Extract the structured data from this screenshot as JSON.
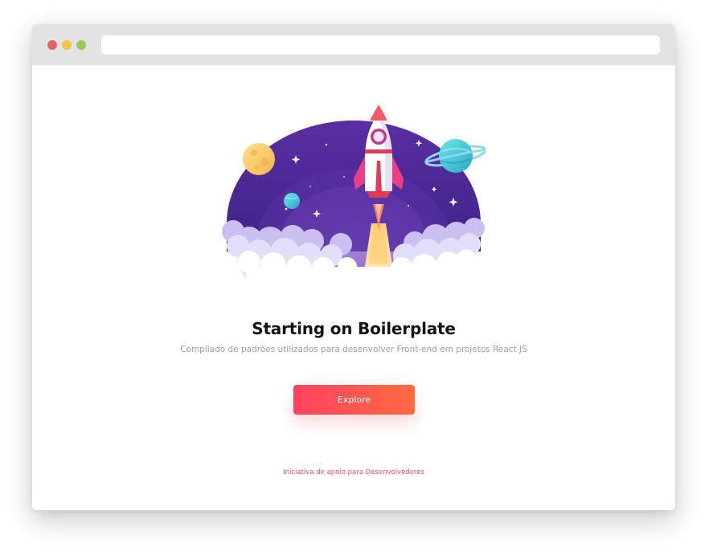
{
  "window": {
    "controls": {
      "close_color": "#e06363",
      "minimize_color": "#f2c545",
      "maximize_color": "#96c95a"
    },
    "address_bar": {
      "value": ""
    }
  },
  "hero": {
    "illustration_icon": "rocket-launch-illustration",
    "title": "Starting on Boilerplate",
    "subtitle": "Compilado de padrões utilizados para desenvolver Front-end em projetos React JS"
  },
  "actions": {
    "explore_label": "Explore",
    "gradient_start": "#ff4262",
    "gradient_end": "#ff6b3e"
  },
  "footer": {
    "link_text": "Iniciativa de apoio para Desenvolvedores",
    "link_color": "#ff4f6c"
  }
}
